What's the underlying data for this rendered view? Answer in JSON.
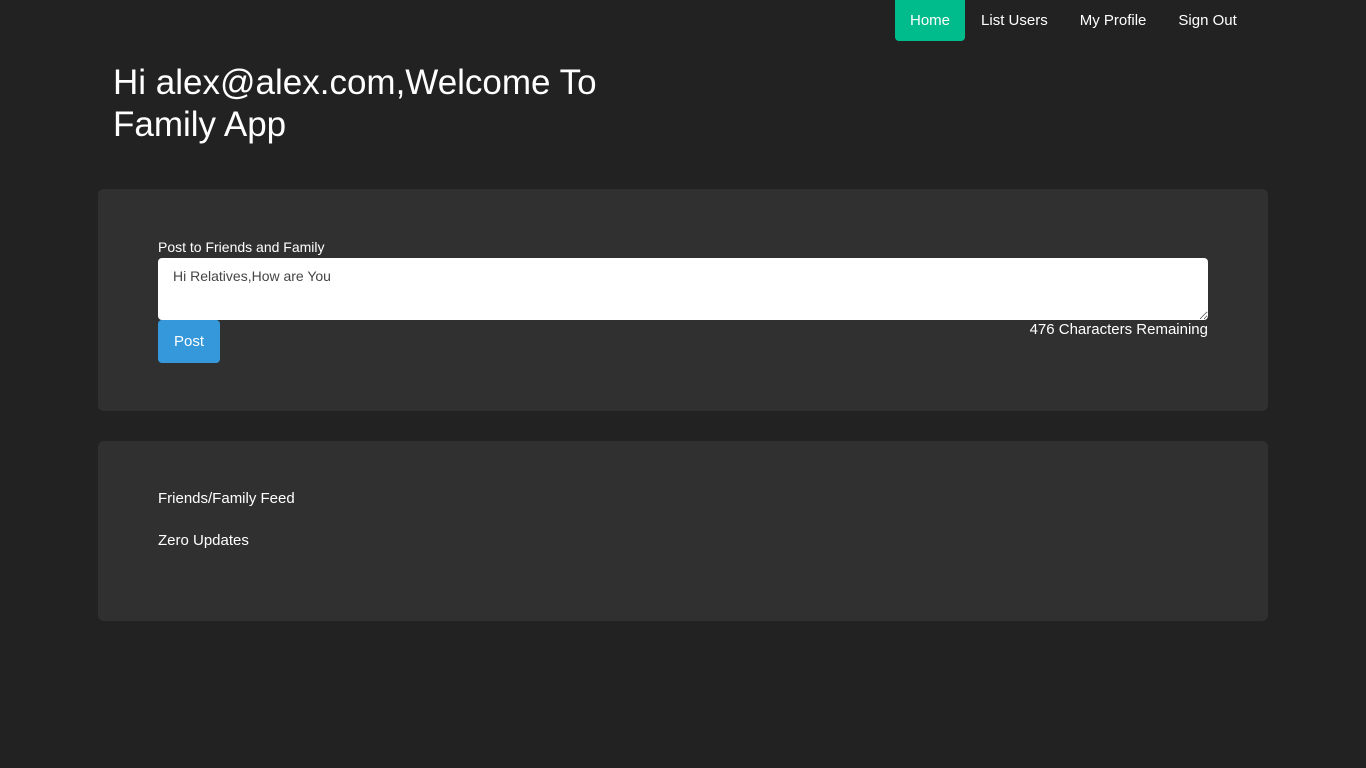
{
  "nav": {
    "items": [
      {
        "label": "Home",
        "active": true
      },
      {
        "label": "List Users",
        "active": false
      },
      {
        "label": "My Profile",
        "active": false
      },
      {
        "label": "Sign Out",
        "active": false
      }
    ]
  },
  "header": {
    "title": "Hi alex@alex.com,Welcome To Family App"
  },
  "post_form": {
    "label": "Post to Friends and Family",
    "textarea_value": "Hi Relatives,How are You",
    "button_label": "Post",
    "chars_remaining": "476 Characters Remaining"
  },
  "feed": {
    "title": "Friends/Family Feed",
    "empty_text": "Zero Updates"
  },
  "colors": {
    "background": "#222222",
    "panel": "#303030",
    "nav_active": "#00bc8c",
    "primary_button": "#3498db"
  }
}
